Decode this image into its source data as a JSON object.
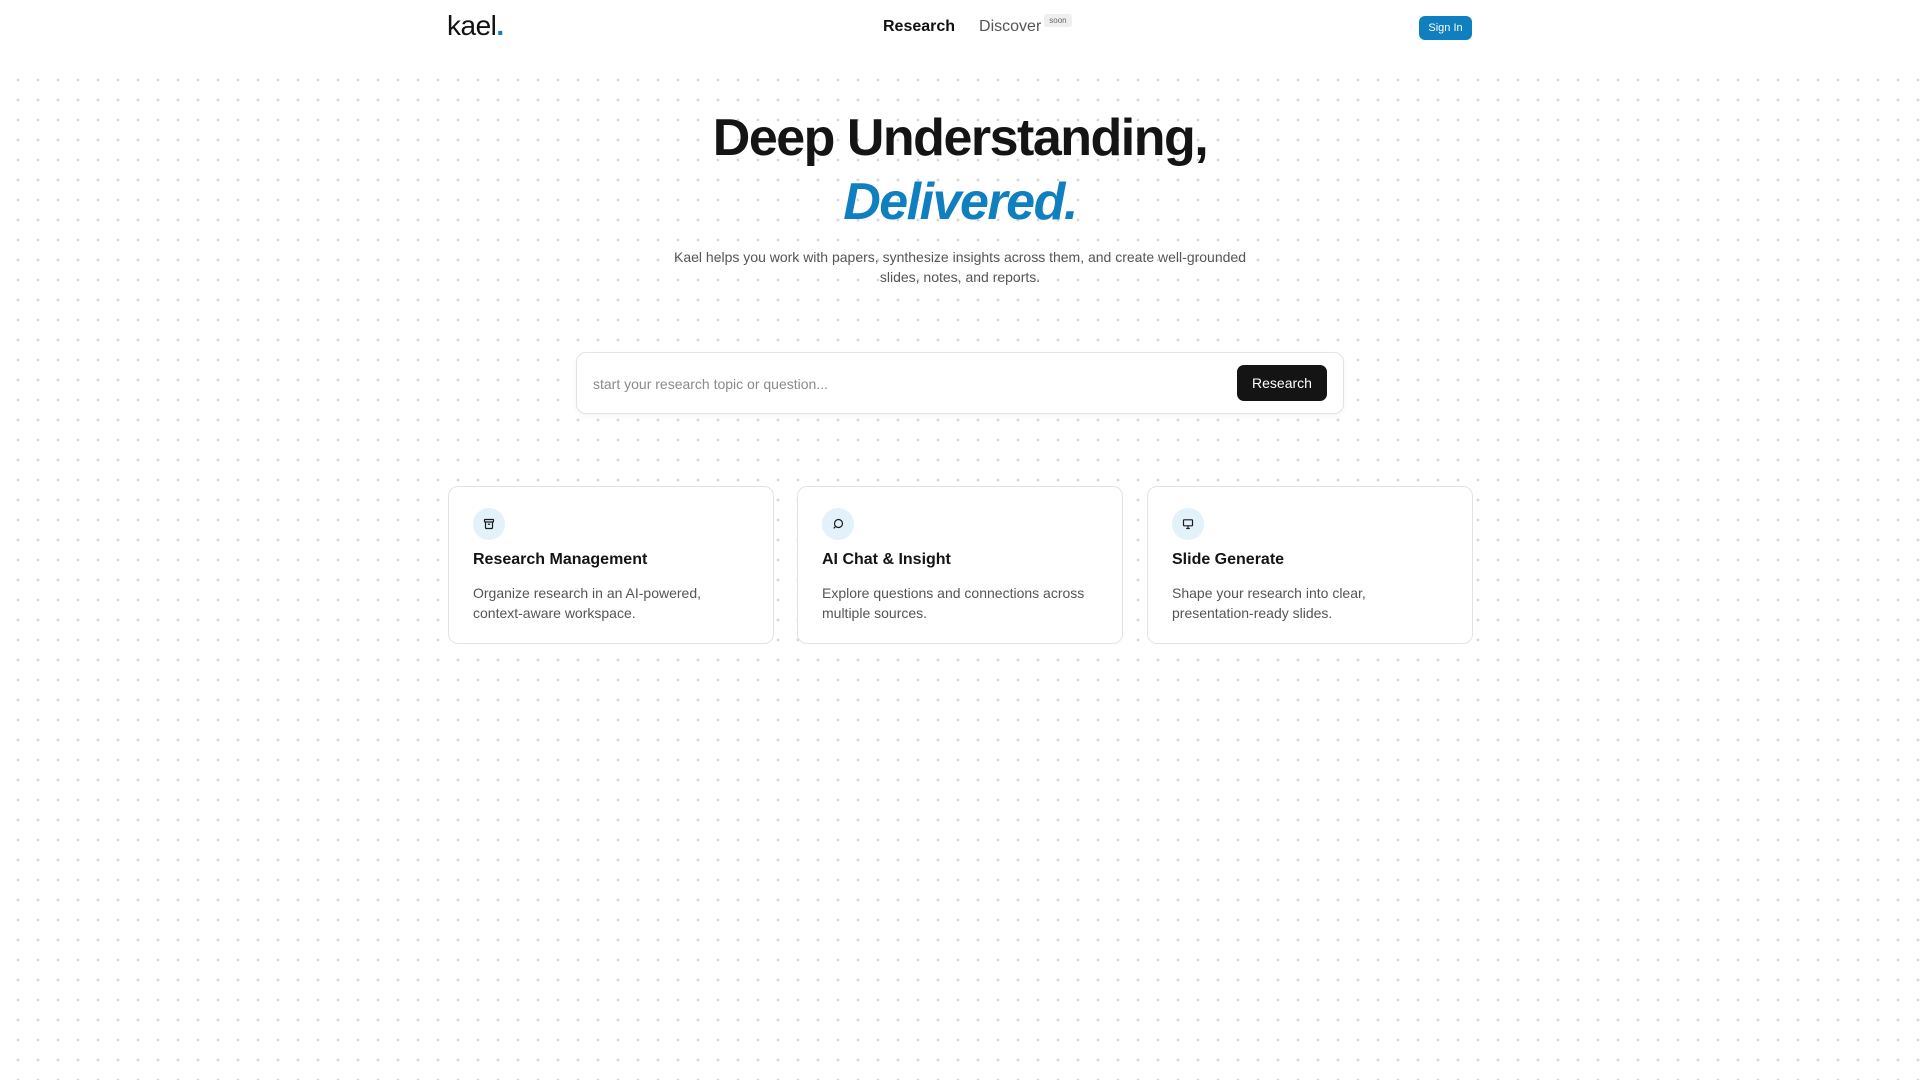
{
  "header": {
    "logo_text": "kael",
    "logo_dot": ".",
    "nav": {
      "research_label": "Research",
      "discover_label": "Discover",
      "discover_badge": "soon"
    },
    "signin_label": "Sign In"
  },
  "hero": {
    "title": "Deep Understanding,",
    "accent": "Delivered.",
    "subtitle": "Kael helps you work with papers, synthesize insights across them, and create well-grounded slides, notes, and reports."
  },
  "search": {
    "placeholder": "start your research topic or question...",
    "value": "",
    "button_label": "Research"
  },
  "features": [
    {
      "icon": "archive-icon",
      "title": "Research Management",
      "description": "Organize research in an AI-powered, context-aware workspace."
    },
    {
      "icon": "chat-bubble-icon",
      "title": "AI Chat & Insight",
      "description": "Explore questions and connections across multiple sources."
    },
    {
      "icon": "presentation-icon",
      "title": "Slide Generate",
      "description": "Shape your research into clear, presentation-ready slides."
    }
  ],
  "colors": {
    "accent": "#0f7fc0",
    "primary_button": "#141414",
    "icon_bg": "#e3f1fb"
  }
}
